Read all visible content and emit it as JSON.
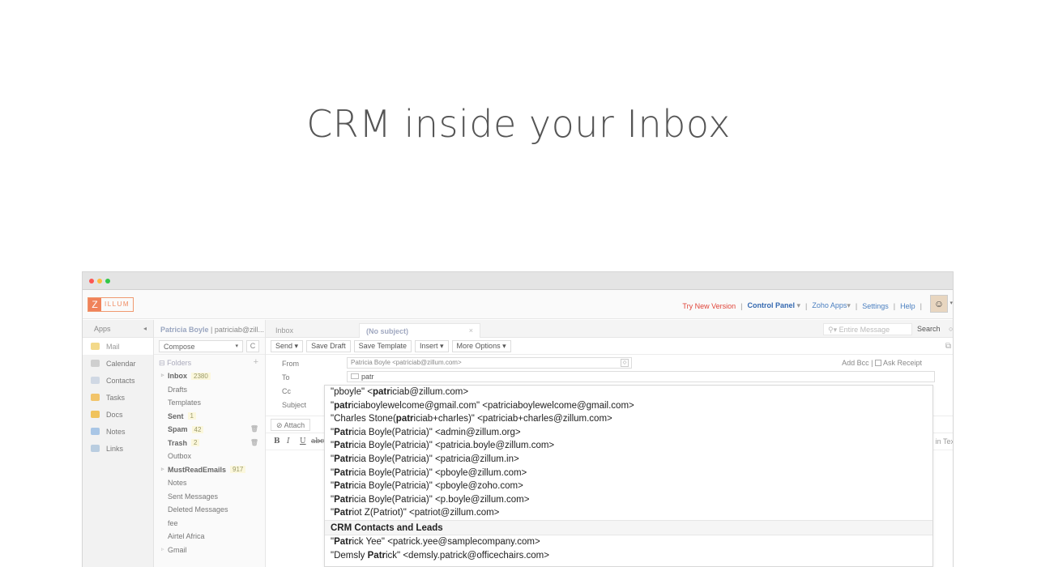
{
  "hero": {
    "title": "CRM inside your Inbox"
  },
  "colors": {
    "accent": "#f0825a",
    "link": "#4a7fc0",
    "alert": "#e0453a"
  },
  "topbar": {
    "logo_letter": "Z",
    "logo_text": "ILLUM",
    "links": {
      "try_new": "Try New Version",
      "control_panel": "Control Panel",
      "zoho_apps": "Zoho Apps",
      "settings": "Settings",
      "help": "Help"
    }
  },
  "apps": {
    "header": "Apps",
    "items": [
      {
        "label": "Mail",
        "icon": "mail-icon"
      },
      {
        "label": "Calendar",
        "icon": "calendar-icon"
      },
      {
        "label": "Contacts",
        "icon": "contacts-icon"
      },
      {
        "label": "Tasks",
        "icon": "tasks-icon"
      },
      {
        "label": "Docs",
        "icon": "docs-icon"
      },
      {
        "label": "Notes",
        "icon": "notes-icon"
      },
      {
        "label": "Links",
        "icon": "links-icon"
      }
    ]
  },
  "account": {
    "name": "Patricia Boyle",
    "email": "patriciab@zill..."
  },
  "compose_label": "Compose",
  "folders": {
    "header": "Folders",
    "items": [
      {
        "label": "Inbox",
        "count": "2380"
      },
      {
        "label": "Drafts"
      },
      {
        "label": "Templates"
      },
      {
        "label": "Sent",
        "count": "1"
      },
      {
        "label": "Spam",
        "count": "42"
      },
      {
        "label": "Trash",
        "count": "2"
      },
      {
        "label": "Outbox"
      },
      {
        "label": "MustReadEmails",
        "count": "917"
      },
      {
        "label": "Notes"
      },
      {
        "label": "Sent Messages"
      },
      {
        "label": "Deleted Messages"
      },
      {
        "label": "fee"
      },
      {
        "label": "Airtel Africa"
      },
      {
        "label": "Gmail"
      }
    ]
  },
  "tabs": {
    "inbox": "Inbox",
    "no_subject": "(No subject)",
    "close": "×"
  },
  "search": {
    "placeholder": "Entire Message",
    "button": "Search"
  },
  "toolbar": {
    "send": "Send",
    "save_draft": "Save Draft",
    "save_template": "Save Template",
    "insert": "Insert",
    "more_options": "More Options"
  },
  "compose": {
    "from_label": "From",
    "from_value": "Patricia Boyle <patriciab@zillum.com>",
    "to_label": "To",
    "to_value": "patr",
    "cc_label": "Cc",
    "subject_label": "Subject",
    "add_bcc": "Add Bcc |",
    "ask_receipt": "Ask Receipt",
    "attach": "Attach",
    "plain_text": "in Tex"
  },
  "suggestions": {
    "items": [
      {
        "pre": "\"pboyle\" <",
        "match": "patr",
        "post": "iciab@zillum.com>"
      },
      {
        "pre": "\"",
        "match": "patr",
        "post": "iciaboylewelcome@gmail.com\" <patriciaboylewelcome@gmail.com>"
      },
      {
        "pre": "\"Charles Stone(",
        "match": "patr",
        "post": "iciab+charles)\" <patriciab+charles@zillum.com>"
      },
      {
        "pre": "\"",
        "match": "Patr",
        "post": "icia Boyle(Patricia)\" <admin@zillum.org>"
      },
      {
        "pre": "\"",
        "match": "Patr",
        "post": "icia Boyle(Patricia)\" <patricia.boyle@zillum.com>"
      },
      {
        "pre": "\"",
        "match": "Patr",
        "post": "icia Boyle(Patricia)\" <patricia@zillum.in>"
      },
      {
        "pre": "\"",
        "match": "Patr",
        "post": "icia Boyle(Patricia)\" <pboyle@zillum.com>"
      },
      {
        "pre": "\"",
        "match": "Patr",
        "post": "icia Boyle(Patricia)\" <pboyle@zoho.com>"
      },
      {
        "pre": "\"",
        "match": "Patr",
        "post": "icia Boyle(Patricia)\" <p.boyle@zillum.com>"
      },
      {
        "pre": "\"",
        "match": "Patr",
        "post": "iot Z(Patriot)\" <patriot@zillum.com>"
      }
    ],
    "crm_header": "CRM Contacts and Leads",
    "crm_items": [
      {
        "pre": "\"",
        "match": "Patr",
        "post": "ick Yee\" <patrick.yee@samplecompany.com>"
      },
      {
        "pre": "\"Demsly ",
        "match": "Patr",
        "post": "ick\" <demsly.patrick@officechairs.com>"
      }
    ]
  }
}
